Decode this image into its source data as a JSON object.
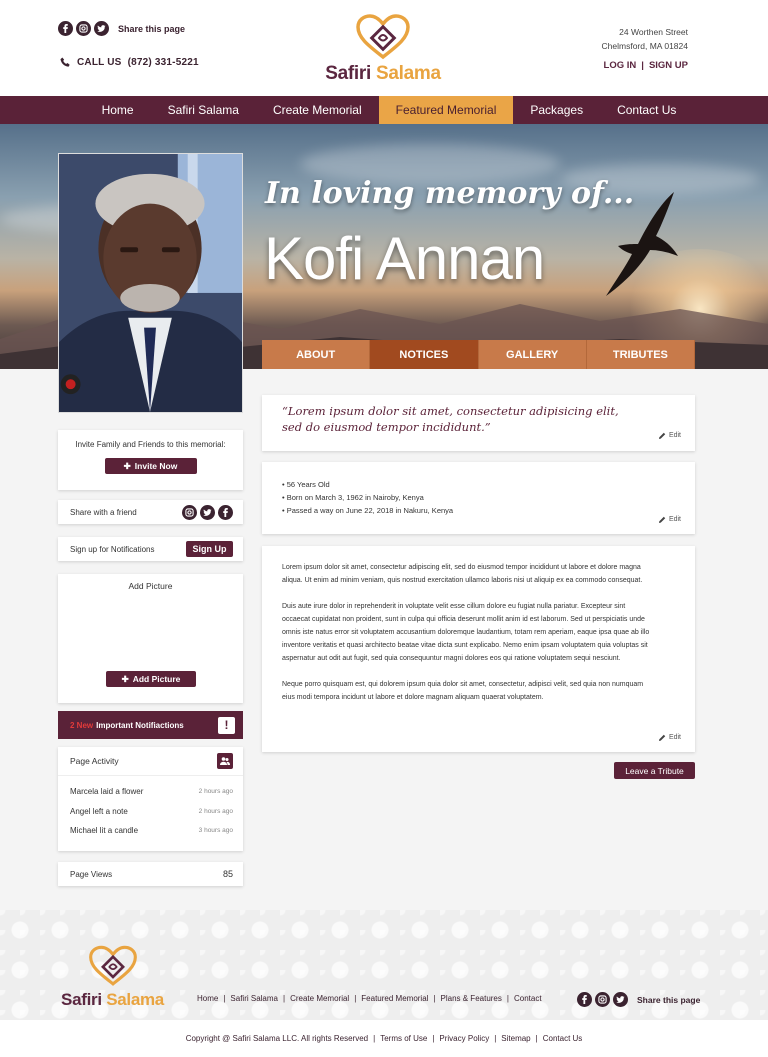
{
  "header": {
    "share_label": "Share this page",
    "call_label": "CALL US",
    "phone": "(872) 331-5221",
    "brand_part1": "Safiri",
    "brand_part2": "Salama",
    "address_line1": "24 Worthen Street",
    "address_line2": "Chelmsford, MA 01824",
    "login": "LOG IN",
    "separator": "|",
    "signup": "SIGN UP"
  },
  "nav": {
    "items": [
      "Home",
      "Safiri Salama",
      "Create Memorial",
      "Featured Memorial",
      "Packages",
      "Contact Us"
    ],
    "active_index": 3
  },
  "hero": {
    "subtitle": "In loving memory of...",
    "name": "Kofi Annan"
  },
  "tabs": [
    "ABOUT",
    "NOTICES",
    "GALLERY",
    "TRIBUTES"
  ],
  "sidebar": {
    "invite_label": "Invite Family and Friends to this memorial:",
    "invite_button": "Invite Now",
    "share_friend": "Share with a friend",
    "notifications_label": "Sign up for Notifications",
    "signup_button": "Sign Up",
    "add_picture_title": "Add Picture",
    "add_picture_button": "Add Picture",
    "important_new": "2 New",
    "important_label": "Important Notifiactions",
    "activity_title": "Page Activity",
    "activity": [
      {
        "text": "Marcela laid a flower",
        "time": "2 hours ago"
      },
      {
        "text": "Angel left a note",
        "time": "2 hours ago"
      },
      {
        "text": "Michael lit a candle",
        "time": "3 hours ago"
      }
    ],
    "views_label": "Page Views",
    "views_count": "85"
  },
  "main": {
    "quote": "“Lorem ipsum dolor sit amet, consectetur adipisicing elit, sed do eiusmod tempor incididunt.”",
    "edit": "Edit",
    "facts": [
      "56 Years Old",
      "Born on March 3, 1962 in Nairoby, Kenya",
      "Passed a way on June 22, 2018 in Nakuru, Kenya"
    ],
    "bio": [
      "Lorem ipsum dolor sit amet, consectetur adipiscing elit, sed do eiusmod tempor incididunt ut labore et dolore magna aliqua. Ut enim ad minim veniam, quis nostrud exercitation ullamco laboris nisi ut aliquip ex ea commodo consequat.",
      "Duis aute irure dolor in reprehenderit in voluptate velit esse cillum dolore eu fugiat nulla pariatur. Excepteur sint occaecat cupidatat non proident, sunt in culpa qui officia deserunt mollit anim id est laborum. Sed ut perspiciatis unde omnis iste natus error sit voluptatem accusantium doloremque laudantium, totam rem aperiam, eaque ipsa quae ab illo inventore veritatis et quasi architecto beatae vitae dicta sunt explicabo. Nemo enim ipsam voluptatem quia voluptas sit aspernatur aut odit aut fugit, sed quia consequuntur magni dolores eos qui ratione voluptatem sequi nesciunt.",
      "Neque porro quisquam est, qui dolorem ipsum quia dolor sit amet, consectetur, adipisci velit, sed quia non numquam eius modi tempora incidunt ut labore et dolore magnam aliquam quaerat voluptatem."
    ],
    "tribute_button": "Leave a Tribute"
  },
  "footer": {
    "links": [
      "Home",
      "Safiri Salama",
      "Create Memorial",
      "Featured Memorial",
      "Plans & Features",
      "Contact"
    ],
    "share_label": "Share this page",
    "copyright_links": [
      "Copyright @ Safiri Salama LLC. All rights Reserved",
      "Terms of Use",
      "Privacy Policy",
      "Sitemap",
      "Contact Us"
    ]
  },
  "colors": {
    "brand_plum": "#5a2238",
    "brand_orange": "#eaa547",
    "tab_orange": "#c87a4a",
    "tab_active": "#a14a1f"
  }
}
